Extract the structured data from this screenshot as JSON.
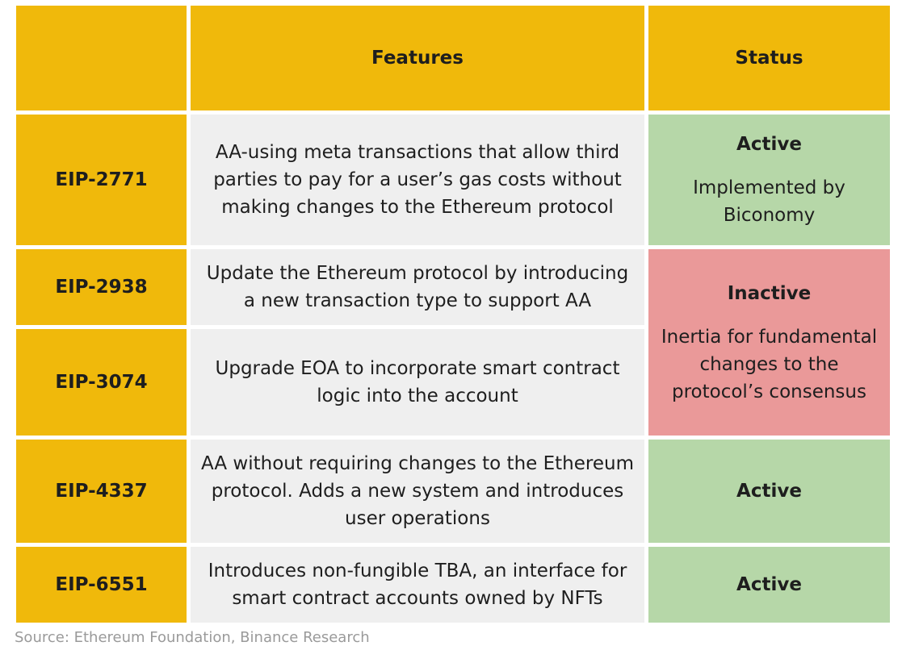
{
  "table": {
    "headers": [
      "",
      "Features",
      "Status"
    ],
    "rows": [
      {
        "eip": "EIP-2771",
        "feature": "AA-using meta transactions that allow third parties to pay for a user’s gas costs without making changes to the Ethereum protocol",
        "status": "Active",
        "status_note": "Implemented by Biconomy"
      },
      {
        "eip": "EIP-2938",
        "feature": "Update the Ethereum protocol by introducing a new transaction type to support AA",
        "status": "Inactive",
        "status_note": "Inertia for fundamental changes to the protocol’s consensus"
      },
      {
        "eip": "EIP-3074",
        "feature": "Upgrade EOA to incorporate smart contract logic into the account",
        "status": "Inactive",
        "status_note": "Inertia for fundamental changes to the protocol’s consensus"
      },
      {
        "eip": "EIP-4337",
        "feature": "AA without requiring changes to the Ethereum protocol. Adds a new system and introduces user operations",
        "status": "Active",
        "status_note": ""
      },
      {
        "eip": "EIP-6551",
        "feature": "Introduces non-fungible TBA, an interface for smart contract accounts owned by NFTs",
        "status": "Active",
        "status_note": ""
      }
    ]
  },
  "colors": {
    "header": "#f0b90b",
    "eip_cell": "#f0b90b",
    "feature_cell": "#efefef",
    "active": "#b6d7a8",
    "inactive": "#ea9999"
  },
  "source": "Source: Ethereum Foundation, Binance Research"
}
